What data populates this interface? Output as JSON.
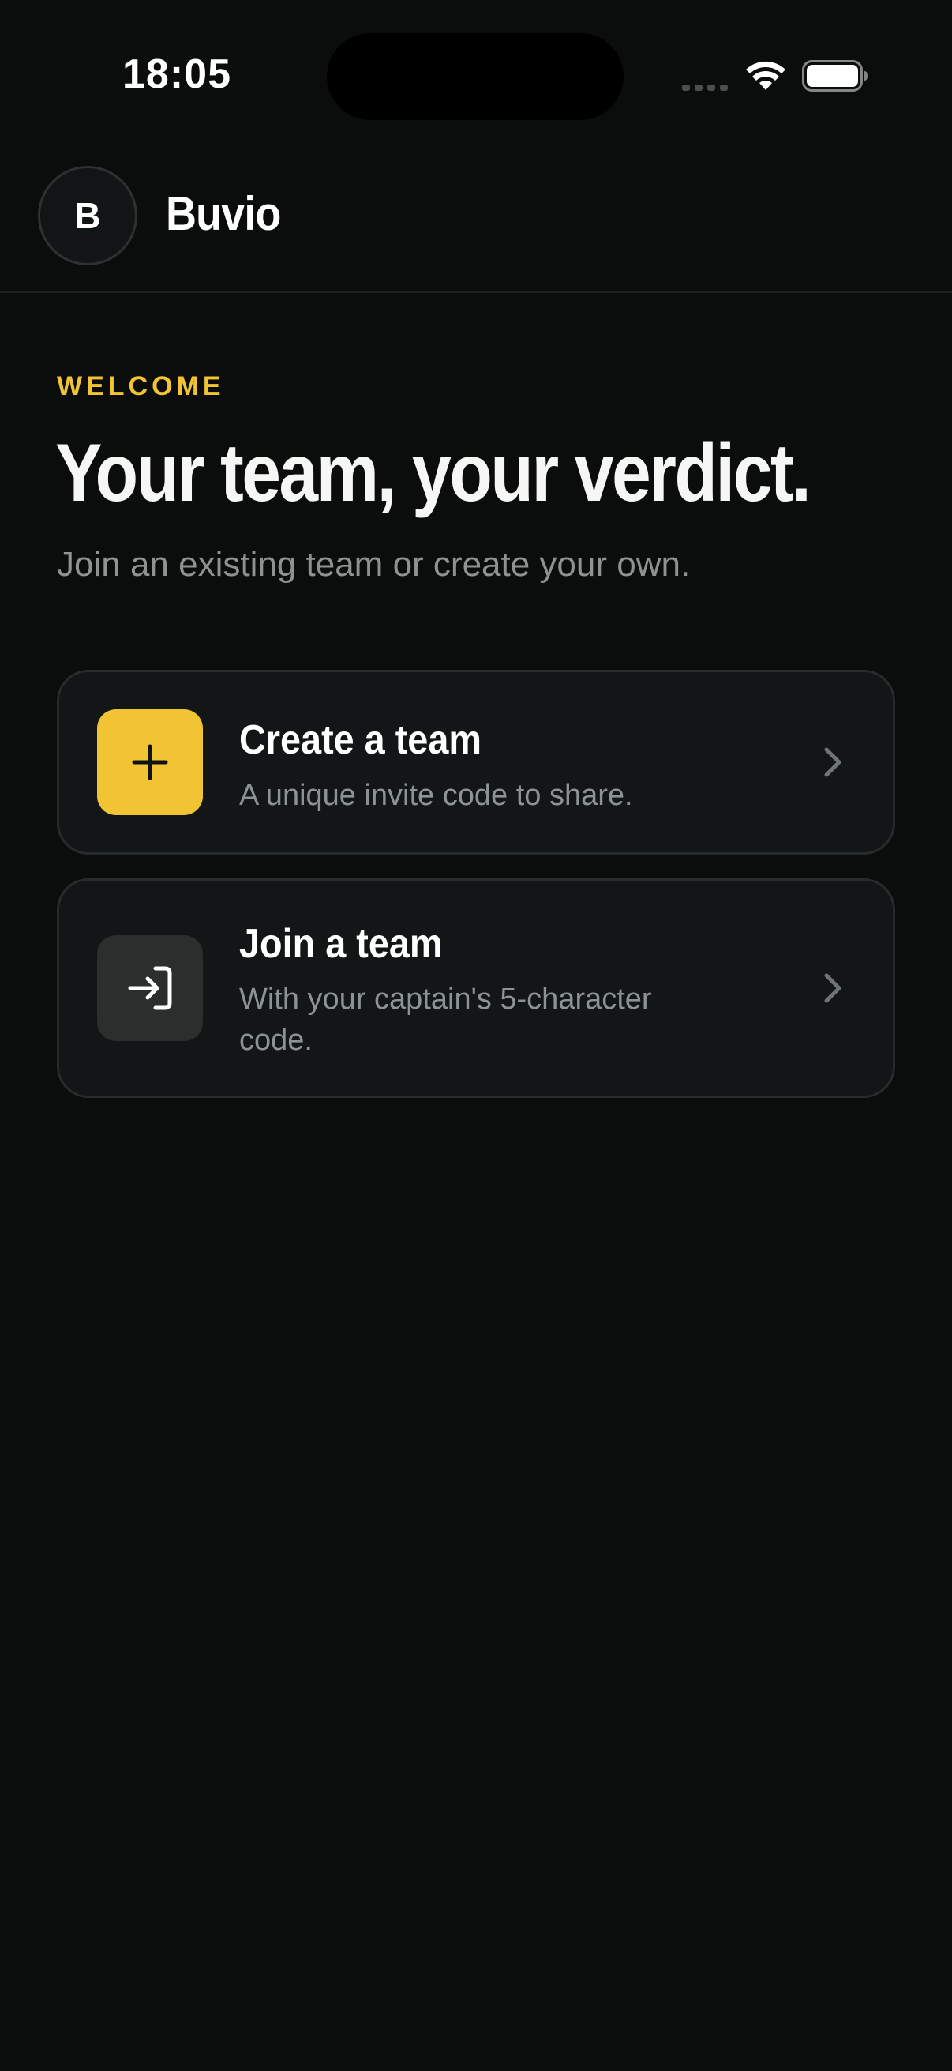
{
  "status_bar": {
    "time": "18:05",
    "icons": [
      "signal-icon",
      "wifi-icon",
      "battery-icon"
    ]
  },
  "header": {
    "avatar_initial": "B",
    "app_name": "Buvio"
  },
  "main": {
    "eyebrow": "WELCOME",
    "headline": "Your team, your verdict.",
    "subtitle": "Join an existing team or create your own.",
    "options": [
      {
        "icon": "plus-icon",
        "title": "Create a team",
        "description": "A unique invite code to share."
      },
      {
        "icon": "sign-in-icon",
        "title": "Join a team",
        "description": "With your captain's 5-character code."
      }
    ]
  },
  "colors": {
    "background": "#0b0d0d",
    "accent": "#f2c433",
    "card": "#131616",
    "card_border": "#262b2b",
    "muted_text": "#8d9292"
  }
}
